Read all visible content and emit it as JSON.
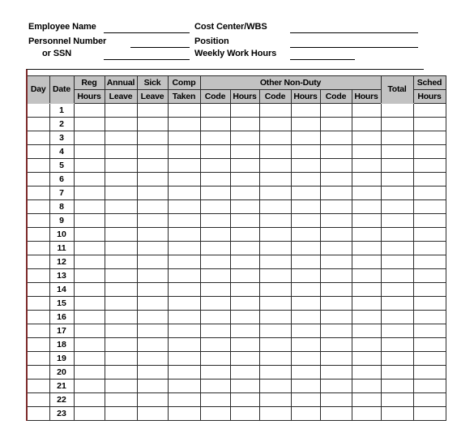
{
  "form": {
    "fields": [
      {
        "label": "Employee Name",
        "value": ""
      },
      {
        "label": "Personnel Number",
        "value": ""
      },
      {
        "label": "or SSN",
        "value": ""
      },
      {
        "label": "Cost Center/WBS",
        "value": ""
      },
      {
        "label": "Position",
        "value": ""
      },
      {
        "label": "Weekly Work Hours",
        "value": ""
      }
    ]
  },
  "table": {
    "group_header": {
      "other_non_duty": "Other Non-Duty"
    },
    "columns": [
      {
        "top": "",
        "bottom": "Day"
      },
      {
        "top": "",
        "bottom": "Date"
      },
      {
        "top": "Reg",
        "bottom": "Hours"
      },
      {
        "top": "Annual",
        "bottom": "Leave"
      },
      {
        "top": "Sick",
        "bottom": "Leave"
      },
      {
        "top": "Comp",
        "bottom": "Taken"
      },
      {
        "top": "",
        "bottom": "Code"
      },
      {
        "top": "",
        "bottom": "Hours"
      },
      {
        "top": "",
        "bottom": "Code"
      },
      {
        "top": "",
        "bottom": "Hours"
      },
      {
        "top": "",
        "bottom": "Code"
      },
      {
        "top": "",
        "bottom": "Hours"
      },
      {
        "top": "",
        "bottom": "Total"
      },
      {
        "top": "Sched",
        "bottom": "Hours"
      }
    ],
    "rows": [
      {
        "day": "",
        "date": "1",
        "reg_hours": "",
        "annual_leave": "",
        "sick_leave": "",
        "comp_taken": "",
        "code1": "",
        "hours1": "",
        "code2": "",
        "hours2": "",
        "code3": "",
        "hours3": "",
        "total": "",
        "sched_hours": ""
      },
      {
        "day": "",
        "date": "2",
        "reg_hours": "",
        "annual_leave": "",
        "sick_leave": "",
        "comp_taken": "",
        "code1": "",
        "hours1": "",
        "code2": "",
        "hours2": "",
        "code3": "",
        "hours3": "",
        "total": "",
        "sched_hours": ""
      },
      {
        "day": "",
        "date": "3",
        "reg_hours": "",
        "annual_leave": "",
        "sick_leave": "",
        "comp_taken": "",
        "code1": "",
        "hours1": "",
        "code2": "",
        "hours2": "",
        "code3": "",
        "hours3": "",
        "total": "",
        "sched_hours": ""
      },
      {
        "day": "",
        "date": "4",
        "reg_hours": "",
        "annual_leave": "",
        "sick_leave": "",
        "comp_taken": "",
        "code1": "",
        "hours1": "",
        "code2": "",
        "hours2": "",
        "code3": "",
        "hours3": "",
        "total": "",
        "sched_hours": ""
      },
      {
        "day": "",
        "date": "5",
        "reg_hours": "",
        "annual_leave": "",
        "sick_leave": "",
        "comp_taken": "",
        "code1": "",
        "hours1": "",
        "code2": "",
        "hours2": "",
        "code3": "",
        "hours3": "",
        "total": "",
        "sched_hours": ""
      },
      {
        "day": "",
        "date": "6",
        "reg_hours": "",
        "annual_leave": "",
        "sick_leave": "",
        "comp_taken": "",
        "code1": "",
        "hours1": "",
        "code2": "",
        "hours2": "",
        "code3": "",
        "hours3": "",
        "total": "",
        "sched_hours": ""
      },
      {
        "day": "",
        "date": "7",
        "reg_hours": "",
        "annual_leave": "",
        "sick_leave": "",
        "comp_taken": "",
        "code1": "",
        "hours1": "",
        "code2": "",
        "hours2": "",
        "code3": "",
        "hours3": "",
        "total": "",
        "sched_hours": ""
      },
      {
        "day": "",
        "date": "8",
        "reg_hours": "",
        "annual_leave": "",
        "sick_leave": "",
        "comp_taken": "",
        "code1": "",
        "hours1": "",
        "code2": "",
        "hours2": "",
        "code3": "",
        "hours3": "",
        "total": "",
        "sched_hours": ""
      },
      {
        "day": "",
        "date": "9",
        "reg_hours": "",
        "annual_leave": "",
        "sick_leave": "",
        "comp_taken": "",
        "code1": "",
        "hours1": "",
        "code2": "",
        "hours2": "",
        "code3": "",
        "hours3": "",
        "total": "",
        "sched_hours": ""
      },
      {
        "day": "",
        "date": "10",
        "reg_hours": "",
        "annual_leave": "",
        "sick_leave": "",
        "comp_taken": "",
        "code1": "",
        "hours1": "",
        "code2": "",
        "hours2": "",
        "code3": "",
        "hours3": "",
        "total": "",
        "sched_hours": ""
      },
      {
        "day": "",
        "date": "11",
        "reg_hours": "",
        "annual_leave": "",
        "sick_leave": "",
        "comp_taken": "",
        "code1": "",
        "hours1": "",
        "code2": "",
        "hours2": "",
        "code3": "",
        "hours3": "",
        "total": "",
        "sched_hours": ""
      },
      {
        "day": "",
        "date": "12",
        "reg_hours": "",
        "annual_leave": "",
        "sick_leave": "",
        "comp_taken": "",
        "code1": "",
        "hours1": "",
        "code2": "",
        "hours2": "",
        "code3": "",
        "hours3": "",
        "total": "",
        "sched_hours": ""
      },
      {
        "day": "",
        "date": "13",
        "reg_hours": "",
        "annual_leave": "",
        "sick_leave": "",
        "comp_taken": "",
        "code1": "",
        "hours1": "",
        "code2": "",
        "hours2": "",
        "code3": "",
        "hours3": "",
        "total": "",
        "sched_hours": ""
      },
      {
        "day": "",
        "date": "14",
        "reg_hours": "",
        "annual_leave": "",
        "sick_leave": "",
        "comp_taken": "",
        "code1": "",
        "hours1": "",
        "code2": "",
        "hours2": "",
        "code3": "",
        "hours3": "",
        "total": "",
        "sched_hours": ""
      },
      {
        "day": "",
        "date": "15",
        "reg_hours": "",
        "annual_leave": "",
        "sick_leave": "",
        "comp_taken": "",
        "code1": "",
        "hours1": "",
        "code2": "",
        "hours2": "",
        "code3": "",
        "hours3": "",
        "total": "",
        "sched_hours": ""
      },
      {
        "day": "",
        "date": "16",
        "reg_hours": "",
        "annual_leave": "",
        "sick_leave": "",
        "comp_taken": "",
        "code1": "",
        "hours1": "",
        "code2": "",
        "hours2": "",
        "code3": "",
        "hours3": "",
        "total": "",
        "sched_hours": ""
      },
      {
        "day": "",
        "date": "17",
        "reg_hours": "",
        "annual_leave": "",
        "sick_leave": "",
        "comp_taken": "",
        "code1": "",
        "hours1": "",
        "code2": "",
        "hours2": "",
        "code3": "",
        "hours3": "",
        "total": "",
        "sched_hours": ""
      },
      {
        "day": "",
        "date": "18",
        "reg_hours": "",
        "annual_leave": "",
        "sick_leave": "",
        "comp_taken": "",
        "code1": "",
        "hours1": "",
        "code2": "",
        "hours2": "",
        "code3": "",
        "hours3": "",
        "total": "",
        "sched_hours": ""
      },
      {
        "day": "",
        "date": "19",
        "reg_hours": "",
        "annual_leave": "",
        "sick_leave": "",
        "comp_taken": "",
        "code1": "",
        "hours1": "",
        "code2": "",
        "hours2": "",
        "code3": "",
        "hours3": "",
        "total": "",
        "sched_hours": ""
      },
      {
        "day": "",
        "date": "20",
        "reg_hours": "",
        "annual_leave": "",
        "sick_leave": "",
        "comp_taken": "",
        "code1": "",
        "hours1": "",
        "code2": "",
        "hours2": "",
        "code3": "",
        "hours3": "",
        "total": "",
        "sched_hours": ""
      },
      {
        "day": "",
        "date": "21",
        "reg_hours": "",
        "annual_leave": "",
        "sick_leave": "",
        "comp_taken": "",
        "code1": "",
        "hours1": "",
        "code2": "",
        "hours2": "",
        "code3": "",
        "hours3": "",
        "total": "",
        "sched_hours": ""
      },
      {
        "day": "",
        "date": "22",
        "reg_hours": "",
        "annual_leave": "",
        "sick_leave": "",
        "comp_taken": "",
        "code1": "",
        "hours1": "",
        "code2": "",
        "hours2": "",
        "code3": "",
        "hours3": "",
        "total": "",
        "sched_hours": ""
      },
      {
        "day": "",
        "date": "23",
        "reg_hours": "",
        "annual_leave": "",
        "sick_leave": "",
        "comp_taken": "",
        "code1": "",
        "hours1": "",
        "code2": "",
        "hours2": "",
        "code3": "",
        "hours3": "",
        "total": "",
        "sched_hours": ""
      }
    ]
  },
  "colors": {
    "header_fill": "#c2c2c2",
    "grid_line": "#2b2b2b",
    "accent_left_border": "#7d2b2b",
    "text": "#000000"
  }
}
